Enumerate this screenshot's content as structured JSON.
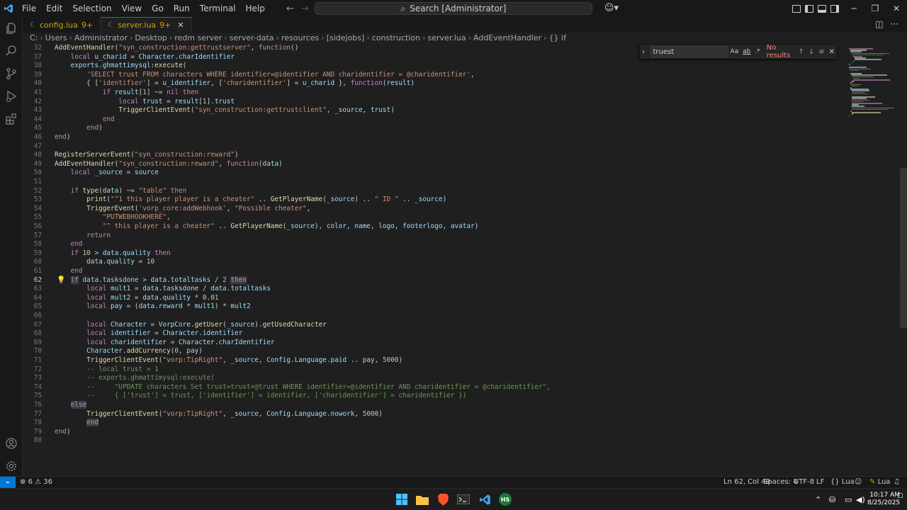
{
  "menu": [
    "File",
    "Edit",
    "Selection",
    "View",
    "Go",
    "Run",
    "Terminal",
    "Help"
  ],
  "search": {
    "label": "Search [Administrator]"
  },
  "tabs": [
    {
      "name": "config.lua",
      "badge": "9+"
    },
    {
      "name": "server.lua",
      "badge": "9+"
    }
  ],
  "breadcrumb": [
    "C:",
    "Users",
    "Administrator",
    "Desktop",
    "redm server",
    "server-data",
    "resources",
    "[sidejobs]",
    "construction",
    "server.lua",
    "AddEventHandler",
    "{} if"
  ],
  "find": {
    "query": "truest",
    "opt_case": "Aa",
    "opt_word": "ab",
    "opt_regex": ".*",
    "result": "No results"
  },
  "code": {
    "current_line": 62,
    "lines": [
      {
        "n": 32,
        "html": "<span class='fn'>AddEventHandler</span>(<span class='str'>\"syn_construction:gettrustserver\"</span>, <span class='kw'>function</span>()"
      },
      {
        "n": 37,
        "html": "    <span class='kw'>local</span> <span class='var'>u_charid</span> = <span class='var'>Character</span>.<span class='var'>charIdentifier</span>"
      },
      {
        "n": 38,
        "html": "    <span class='var'>exports</span>.<span class='var'>ghmattimysql</span>:<span class='fn'>execute</span>("
      },
      {
        "n": 39,
        "html": "        <span class='str'>'SELECT trust FROM characters WHERE identifier=@identifier AND charidentifier = @charidentifier'</span>,"
      },
      {
        "n": 40,
        "html": "        { [<span class='str'>'identifier'</span>] = <span class='var'>u_identifier</span>, [<span class='str'>'charidentifier'</span>] = <span class='var'>u_charid</span> }, <span class='kw'>function</span>(<span class='var'>result</span>)"
      },
      {
        "n": 41,
        "html": "            <span class='kw'>if</span> <span class='var'>result</span>[<span class='num'>1</span>] ~= <span class='kw'>nil</span> <span class='kw'>then</span>"
      },
      {
        "n": 42,
        "html": "                <span class='kw'>local</span> <span class='var'>trust</span> = <span class='var'>result</span>[<span class='num'>1</span>].<span class='var'>trust</span>"
      },
      {
        "n": 43,
        "html": "                <span class='fn'>TriggerClientEvent</span>(<span class='str'>\"syn_construction:gettrustclient\"</span>, <span class='var'>_source</span>, <span class='var'>trust</span>)"
      },
      {
        "n": 44,
        "html": "            <span class='kw'>end</span>"
      },
      {
        "n": 45,
        "html": "        <span class='kw'>end</span>)"
      },
      {
        "n": 46,
        "html": "<span class='kw'>end</span>)"
      },
      {
        "n": 47,
        "html": ""
      },
      {
        "n": 48,
        "html": "<span class='fn'>RegisterServerEvent</span>(<span class='str'>\"syn_construction:reward\"</span>)"
      },
      {
        "n": 49,
        "html": "<span class='fn'>AddEventHandler</span>(<span class='str'>\"syn_construction:reward\"</span>, <span class='kw'>function</span>(<span class='var'>data</span>)"
      },
      {
        "n": 50,
        "html": "    <span class='kw'>local</span> <span class='var'>_source</span> = <span class='var'>source</span>"
      },
      {
        "n": 51,
        "html": ""
      },
      {
        "n": 52,
        "html": "    <span class='kw'>if</span> <span class='fn'>type</span>(<span class='var'>data</span>) ~= <span class='str'>\"table\"</span> <span class='kw'>then</span>"
      },
      {
        "n": 53,
        "html": "        <span class='fn'>print</span>(<span class='str'>\"^1 this player player is a cheater\"</span> .. <span class='fn'>GetPlayerName</span>(<span class='var'>_source</span>) .. <span class='str'>\" ID \"</span> .. <span class='var'>_source</span>)"
      },
      {
        "n": 54,
        "html": "        <span class='fn'>TriggerEvent</span>(<span class='str'>'vorp_core:addWebhook'</span>, <span class='str'>\"Possible cheater\"</span>,"
      },
      {
        "n": 55,
        "html": "            <span class='str'>\"PUTWEBHOOKHERE\"</span>,"
      },
      {
        "n": 56,
        "html": "            <span class='str'>\"^ this player is a cheater\"</span> .. <span class='fn'>GetPlayerName</span>(<span class='var'>_source</span>), <span class='var'>color</span>, <span class='var'>name</span>, <span class='var'>logo</span>, <span class='var'>footerlogo</span>, <span class='var'>avatar</span>)"
      },
      {
        "n": 57,
        "html": "        <span class='kw'>return</span>"
      },
      {
        "n": 58,
        "html": "    <span class='kw'>end</span>"
      },
      {
        "n": 59,
        "html": "    <span class='kw'>if</span> <span class='num'>10</span> &gt; <span class='var'>data</span>.<span class='var'>quality</span> <span class='kw'>then</span>"
      },
      {
        "n": 60,
        "html": "        <span class='var'>data</span>.<span class='var'>quality</span> = <span class='num'>10</span>"
      },
      {
        "n": 61,
        "html": "    <span class='kw'>end</span>"
      },
      {
        "n": 62,
        "html": "    <span class='kw sel'>if</span> <span class='var'>data</span>.<span class='var'>tasksdone</span> &gt; <span class='var'>data</span>.<span class='var'>totaltasks</span> / <span class='num'>2</span> <span class='kw sel'>then</span>"
      },
      {
        "n": 63,
        "html": "        <span class='kw'>local</span> <span class='var'>mult1</span> = <span class='var'>data</span>.<span class='var'>tasksdone</span> / <span class='var'>data</span>.<span class='var'>totaltasks</span>"
      },
      {
        "n": 64,
        "html": "        <span class='kw'>local</span> <span class='var'>mult2</span> = <span class='var'>data</span>.<span class='var'>quality</span> * <span class='num'>0.01</span>"
      },
      {
        "n": 65,
        "html": "        <span class='kw'>local</span> <span class='var'>pay</span> = (<span class='var'>data</span>.<span class='var'>reward</span> * <span class='var'>mult1</span>) * <span class='var'>mult2</span>"
      },
      {
        "n": 66,
        "html": ""
      },
      {
        "n": 67,
        "html": "        <span class='kw'>local</span> <span class='var'>Character</span> = <span class='var'>VorpCore</span>.<span class='fn'>getUser</span>(<span class='var'>_source</span>).<span class='fn'>getUsedCharacter</span>"
      },
      {
        "n": 68,
        "html": "        <span class='kw'>local</span> <span class='var'>identifier</span> = <span class='var'>Character</span>.<span class='var'>identifier</span>"
      },
      {
        "n": 69,
        "html": "        <span class='kw'>local</span> <span class='var'>charidentifier</span> = <span class='var'>Character</span>.<span class='var'>charIdentifier</span>"
      },
      {
        "n": 70,
        "html": "        <span class='var'>Character</span>.<span class='fn'>addCurrency</span>(<span class='num'>0</span>, <span class='var'>pay</span>)"
      },
      {
        "n": 71,
        "html": "        <span class='fn'>TriggerClientEvent</span>(<span class='str'>\"vorp:TipRight\"</span>, <span class='var'>_source</span>, <span class='var'>Config</span>.<span class='var'>Language</span>.<span class='var'>paid</span> .. <span class='var'>pay</span>, <span class='num'>5000</span>)"
      },
      {
        "n": 72,
        "html": "        <span class='cmt'>-- local trust = 1</span>"
      },
      {
        "n": 73,
        "html": "        <span class='cmt'>-- exports.ghmattimysql:execute(</span>"
      },
      {
        "n": 74,
        "html": "        <span class='cmt'>--     \"UPDATE characters Set trust=trust+@trust WHERE identifier=@identifier AND charidentifier = @charidentifier\",</span>"
      },
      {
        "n": 75,
        "html": "        <span class='cmt'>--     { ['trust'] = trust, ['identifier'] = identifier, ['charidentifier'] = charidentifier })</span>"
      },
      {
        "n": 76,
        "html": "    <span class='kw sel'>else</span>"
      },
      {
        "n": 77,
        "html": "        <span class='fn'>TriggerClientEvent</span>(<span class='str'>\"vorp:TipRight\"</span>, <span class='var'>_source</span>, <span class='var'>Config</span>.<span class='var'>Language</span>.<span class='var'>nowork</span>, <span class='num'>5000</span>)"
      },
      {
        "n": 78,
        "html": "        <span class='kw sel'>end</span>"
      },
      {
        "n": 79,
        "html": "<span class='kw'>end</span>)"
      },
      {
        "n": 80,
        "html": ""
      }
    ]
  },
  "status": {
    "errors": "6",
    "warnings": "36",
    "position": "Ln 62, Col 49",
    "spaces": "Spaces: 4",
    "encoding": "UTF-8",
    "eol": "LF",
    "language": "Lua",
    "lua_ext": "Lua"
  },
  "taskbar": {
    "time": "10:17 AM",
    "date": "8/25/2025",
    "hs_label": "HS"
  },
  "colors": {
    "accent": "#0078d4",
    "error": "#f48771"
  }
}
